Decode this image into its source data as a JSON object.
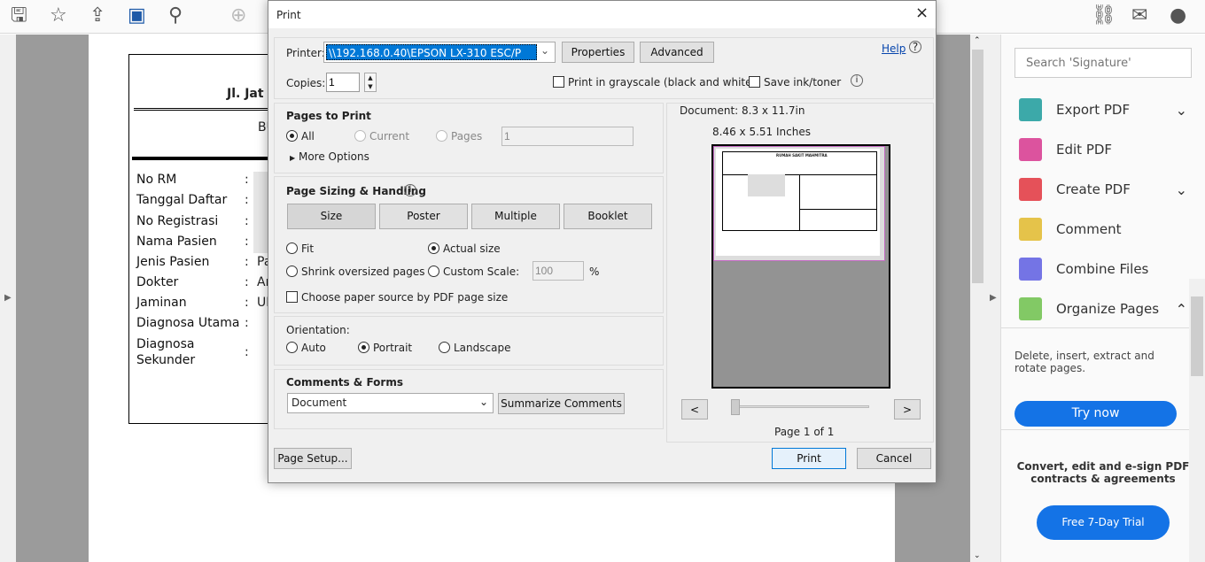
{
  "toolbar": {
    "icons": [
      "save-icon",
      "star-icon",
      "upload-cloud-icon",
      "print-icon",
      "search-zoom-icon",
      "page-up-icon"
    ],
    "right_icons": [
      "share-link-icon",
      "mail-icon",
      "add-user-icon"
    ]
  },
  "document": {
    "header": "Jl. Jat",
    "sub": "BU",
    "fields": [
      {
        "label": "No RM",
        "value": ""
      },
      {
        "label": "Tanggal Daftar",
        "value": ""
      },
      {
        "label": "No Registrasi",
        "value": ""
      },
      {
        "label": "Nama Pasien",
        "value": ""
      },
      {
        "label": "Jenis Pasien",
        "value": "Pa"
      },
      {
        "label": "Dokter",
        "value": "Ar"
      },
      {
        "label": "Jaminan",
        "value": "UI"
      },
      {
        "label": "Diagnosa Utama",
        "value": ""
      },
      {
        "label": "Diagnosa Sekunder",
        "value": ""
      }
    ],
    "colon": ":"
  },
  "dialog": {
    "title": "Print",
    "close": "×",
    "printer_label": "Printer:",
    "printer_value": "\\\\192.168.0.40\\EPSON LX-310 ESC/P",
    "properties": "Properties",
    "advanced": "Advanced",
    "help": "Help",
    "copies_label": "Copies:",
    "copies_value": "1",
    "grayscale": "Print in grayscale (black and white)",
    "save_ink": "Save ink/toner",
    "pages_title": "Pages to Print",
    "all": "All",
    "current": "Current",
    "pages": "Pages",
    "pages_value": "1",
    "more_options": "More Options",
    "sizing_title": "Page Sizing & Handling",
    "size": "Size",
    "poster": "Poster",
    "multiple": "Multiple",
    "booklet": "Booklet",
    "fit": "Fit",
    "actual": "Actual size",
    "shrink": "Shrink oversized pages",
    "custom": "Custom Scale:",
    "custom_value": "100",
    "percent": "%",
    "paper_source": "Choose paper source by PDF page size",
    "orientation_title": "Orientation:",
    "auto": "Auto",
    "portrait": "Portrait",
    "landscape": "Landscape",
    "comments_title": "Comments & Forms",
    "comments_value": "Document",
    "summarize": "Summarize Comments",
    "doc_size": "Document: 8.3 x 11.7in",
    "paper_size": "8.46 x 5.51 Inches",
    "prev": "<",
    "next": ">",
    "page_of": "Page 1 of 1",
    "page_setup": "Page Setup...",
    "print": "Print",
    "cancel": "Cancel",
    "preview": {
      "title": "RUMAH SAKIT MAHMITRA"
    }
  },
  "right_pane": {
    "search_placeholder": "Search 'Signature'",
    "tools": [
      {
        "label": "Export PDF",
        "color": "#1a9a9a",
        "chev": "⌄"
      },
      {
        "label": "Edit PDF",
        "color": "#d6358d",
        "chev": ""
      },
      {
        "label": "Create PDF",
        "color": "#e0323c",
        "chev": "⌄"
      },
      {
        "label": "Comment",
        "color": "#e0b92a",
        "chev": ""
      },
      {
        "label": "Combine Files",
        "color": "#5c5ce0",
        "chev": ""
      },
      {
        "label": "Organize Pages",
        "color": "#6cc04a",
        "chev": "⌃"
      }
    ],
    "organize_desc": "Delete, insert, extract and rotate pages.",
    "try_now": "Try now",
    "promo": "Convert, edit and e-sign PDF contracts & agreements",
    "trial": "Free 7-Day Trial",
    "accent": "#1473e6"
  }
}
